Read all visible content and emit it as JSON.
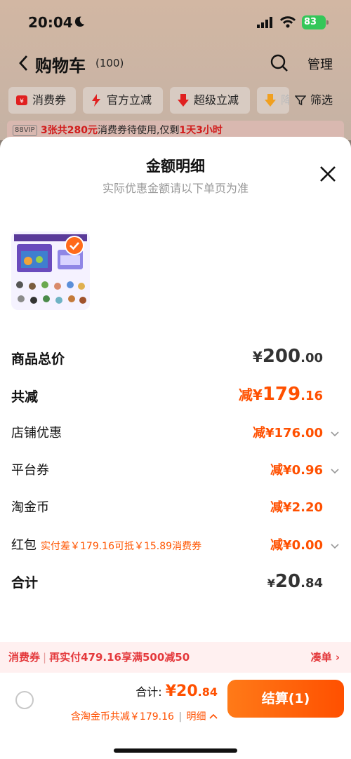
{
  "status_bar": {
    "time": "20:04",
    "battery": "83"
  },
  "nav": {
    "title": "购物车",
    "count": "(100)",
    "manage": "管理"
  },
  "chips": [
    {
      "label": "消费券"
    },
    {
      "label": "官方立减"
    },
    {
      "label": "超级立减"
    },
    {
      "label": "降"
    }
  ],
  "filter_label": "筛选",
  "vip_bar": {
    "badge": "88VIP",
    "highlight": "3张共280元",
    "text": "消费券待使用,仅剩",
    "remain": "1天3小时"
  },
  "sheet": {
    "title": "金额明细",
    "subtitle": "实际优惠金额请以下单页为准",
    "rows": [
      {
        "label": "商品总价",
        "prefix": "",
        "yen": "¥",
        "int": "200",
        "dec": ".00"
      },
      {
        "label": "共减",
        "prefix": "减",
        "yen": "¥",
        "int": "179",
        "dec": ".16"
      },
      {
        "label": "店铺优惠",
        "prefix": "减",
        "yen": "¥",
        "int": "176",
        "dec": ".00"
      },
      {
        "label": "平台券",
        "prefix": "减",
        "yen": "¥",
        "int": "0",
        "dec": ".96"
      },
      {
        "label": "淘金币",
        "prefix": "减",
        "yen": "¥",
        "int": "2",
        "dec": ".20"
      },
      {
        "label": "红包",
        "note": "实付差￥179.16可抵￥15.89消费券",
        "prefix": "减",
        "yen": "¥",
        "int": "0",
        "dec": ".00"
      },
      {
        "label": "合计",
        "prefix": "",
        "yen": "¥",
        "int": "20",
        "dec": ".84"
      }
    ]
  },
  "promo": {
    "tag": "消费券",
    "text": "再实付479.16享满500减50",
    "action": "凑单 ›"
  },
  "bottom": {
    "total_label": "合计:",
    "yen": "¥",
    "total_int": "20",
    "total_dec": ".84",
    "discount_text": "含淘金币共减￥179.16",
    "detail_label": "明细",
    "checkout_label": "结算(1)"
  },
  "colors": {
    "accent": "#ff5000",
    "promo_red": "#e4393c"
  }
}
